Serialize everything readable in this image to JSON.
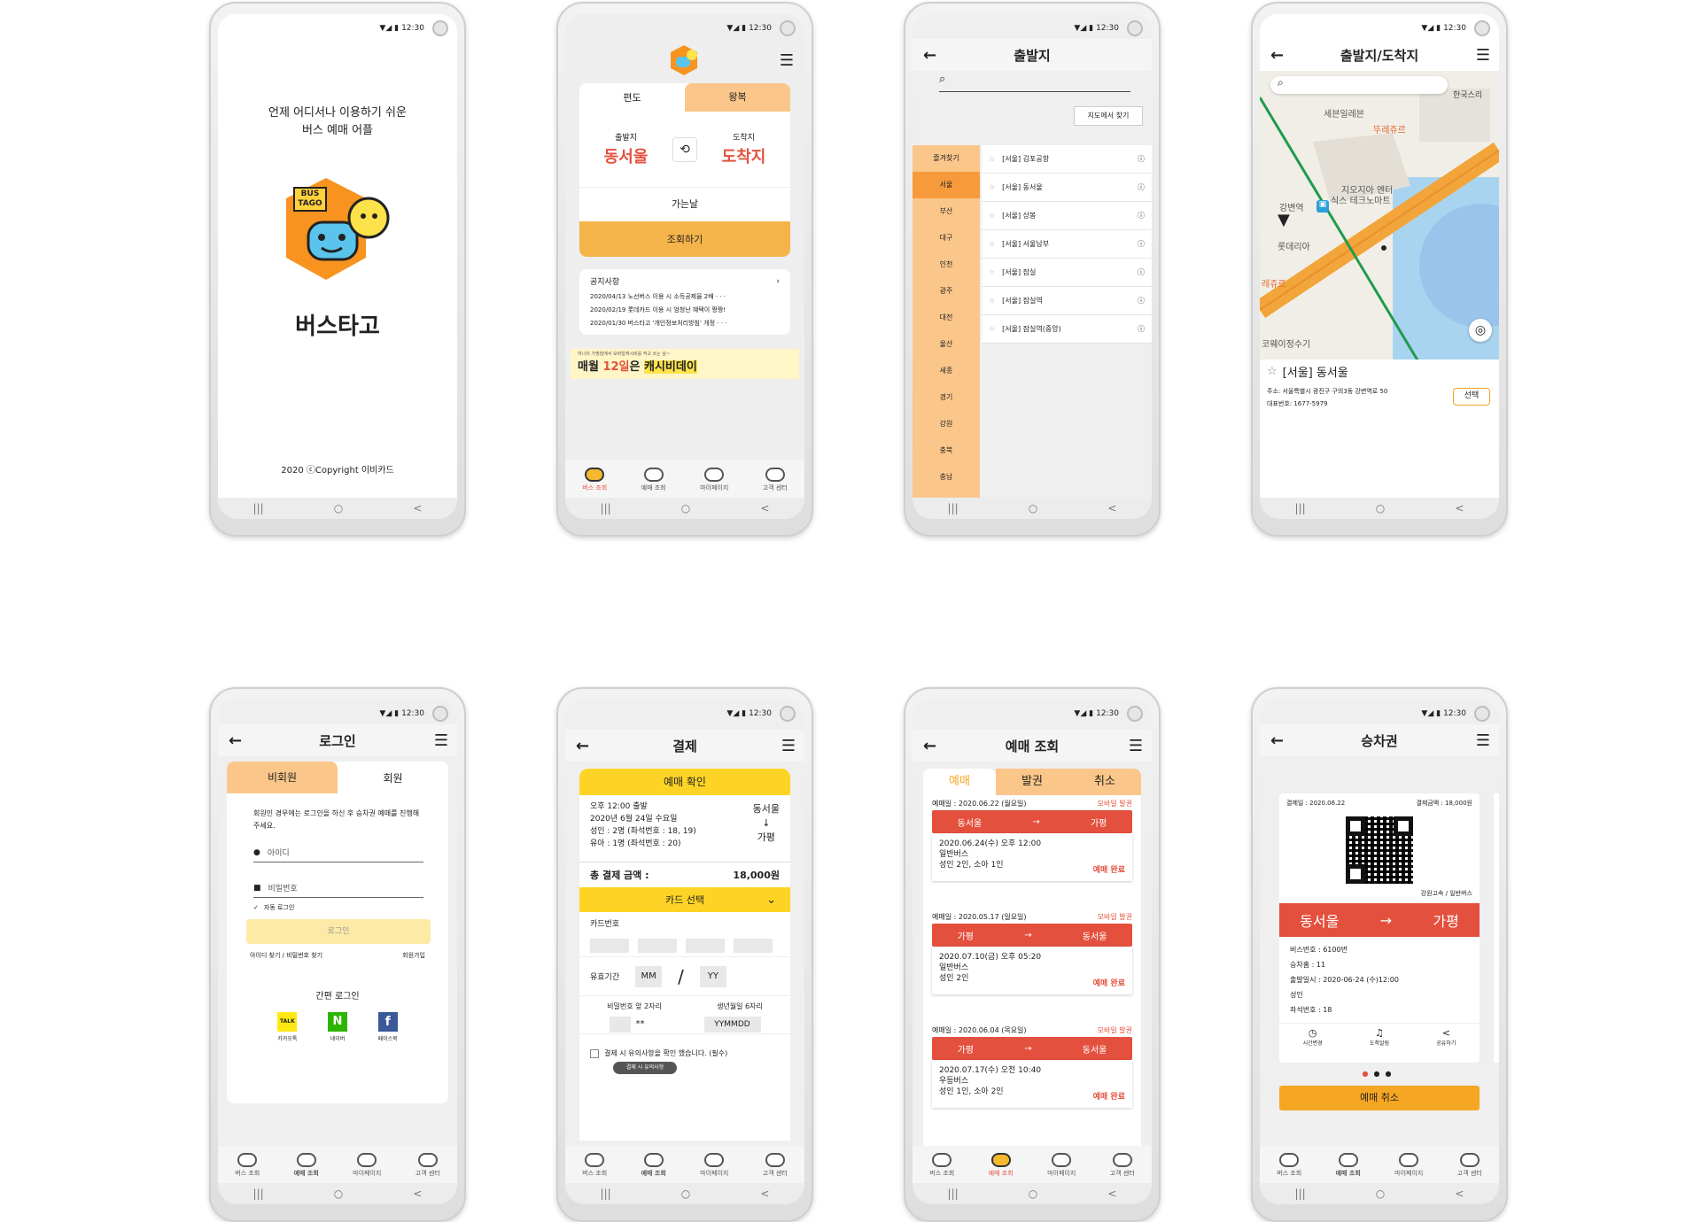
{
  "status_time": "12:30",
  "sys_nav": [
    "|||",
    "○",
    "<"
  ],
  "nav": {
    "search": "버스 조회",
    "booking": "예매 조회",
    "mypage": "마이페이지",
    "cs": "고객 센터"
  },
  "splash": {
    "tagline1": "언제 어디서나 이용하기 쉬운",
    "tagline2": "버스 예매 어플",
    "logo_text1": "BUS",
    "logo_text2": "TAGO",
    "app_name": "버스타고",
    "copyright": "2020 ⓒCopyright 이비카드"
  },
  "home": {
    "tab_oneway": "편도",
    "tab_round": "왕복",
    "depart_label": "출발지",
    "arrive_label": "도착지",
    "depart_value": "동서울",
    "arrive_value": "도착지",
    "date_label": "가는날",
    "search_btn": "조회하기",
    "notice_title": "공지사항",
    "notices": [
      "2020/04/13 노선버스 이용 시 소득공제율 2배 · · ·",
      "2020/02/19 롯데카드 이용 시 엄청난 혜택이 짱짱!",
      "2020/01/30 버스타고 '개인정보처리방침' 개정 · · ·"
    ],
    "banner_small": "하나의 가맹점에서 모바일캐시비를 적고 쓰는 날~",
    "banner_main1": "매월 ",
    "banner_main2": "12일",
    "banner_main3": "은 ",
    "banner_main4": "캐시비데이"
  },
  "departure": {
    "title": "출발지",
    "map_btn": "지도에서 찾기",
    "regions": [
      "즐겨찾기",
      "서울",
      "부산",
      "대구",
      "인천",
      "광주",
      "대전",
      "울산",
      "세종",
      "경기",
      "강원",
      "충북",
      "충남"
    ],
    "terminals": [
      "[서울] 김포공항",
      "[서울] 동서울",
      "[서울] 상봉",
      "[서울] 서울남부",
      "[서울] 잠실",
      "[서울] 잠실역",
      "[서울] 잠실역(중앙)"
    ]
  },
  "map": {
    "title": "출발지/도착지",
    "labels": [
      "세븐일레븐",
      "뚜레쥬르",
      "지오지아 엔터",
      "식스 테크노마트",
      "강변역",
      "롯데리아",
      "레쥬르",
      "코웨이정수기",
      "한국스리"
    ],
    "place_name": "[서울] 동서울",
    "address": "주소: 서울특별시 광진구 구의3동 강변역로 50",
    "phone": "대표번호: 1677-5979",
    "select_btn": "선택"
  },
  "login": {
    "title": "로그인",
    "tab_guest": "비회원",
    "tab_member": "회원",
    "info": "회원인 경우에는 로그인을 하신 후 승차권 예매를 진행해주세요.",
    "id_placeholder": "아이디",
    "pw_placeholder": "비밀번호",
    "auto_login": "자동 로그인",
    "login_btn": "로그인",
    "find": "아이디 찾기 / 비밀번호 찾기",
    "signup": "회원가입",
    "simple_login": "간편 로그인",
    "kakao": "카카오톡",
    "naver": "네이버",
    "facebook": "페이스북",
    "kakao_icon": "TALK",
    "naver_icon": "N",
    "facebook_icon": "f"
  },
  "payment": {
    "title": "결제",
    "confirm_title": "예매 확인",
    "line1": "오후 12:00 출발",
    "line2": "2020년 6월 24일 수요일",
    "line3": "성인 : 2명 (좌석번호 : 18, 19)",
    "line4": "유아 : 1명 (좌석번호 : 20)",
    "from": "동서울",
    "to": "가평",
    "arrow": "↓",
    "total_label": "총 결제 금액 :",
    "total_value": "18,000원",
    "card_select": "카드 선택",
    "card_no": "카드번호",
    "expiry": "유효기간",
    "mm": "MM",
    "yy": "YY",
    "pw2": "비밀번호 앞 2자리",
    "pw2_mask": "**",
    "birth": "생년월일 6자리",
    "birth_ph": "YYMMDD",
    "agree": "결제 시 유의사항을 확인 했습니다. (필수)",
    "notice_chip": "결제 시 유의사항"
  },
  "history": {
    "title": "예매 조회",
    "tabs": [
      "예매",
      "발권",
      "취소"
    ],
    "items": [
      {
        "date": "예매일 : 2020.06.22 (월요일)",
        "tag": "모바일 발권",
        "from": "동서울",
        "to": "가평",
        "when": "2020.06.24(수) 오후 12:00",
        "type": "일반버스",
        "pax": "성인 2인, 소아 1인",
        "status": "예매 완료"
      },
      {
        "date": "예매일 : 2020.05.17 (일요일)",
        "tag": "모바일 발권",
        "from": "가평",
        "to": "동서울",
        "when": "2020.07.10(금) 오후 05:20",
        "type": "일반버스",
        "pax": "성인 2인",
        "status": "예매 완료"
      },
      {
        "date": "예매일 : 2020.06.04 (목요일)",
        "tag": "모바일 발권",
        "from": "가평",
        "to": "동서울",
        "when": "2020.07.17(수) 오전 10:40",
        "type": "우등버스",
        "pax": "성인 1인, 소아 2인",
        "status": "예매 완료"
      }
    ],
    "arrow": "→"
  },
  "ticket": {
    "title": "승차권",
    "pay_date": "결제일 : 2020.06.22",
    "pay_amount": "결제금액 : 18,000원",
    "company": "강원고속 / 일반버스",
    "from": "동서울",
    "to": "가평",
    "arrow": "→",
    "bus_no": "버스번호 : 6100번",
    "platform": "승차홈 : 11",
    "depart": "출발일시 : 2020-06-24 (수)12:00",
    "grade": "성인",
    "seat": "좌석번호 : 18",
    "act_time": "시간변경",
    "act_alarm": "도착알림",
    "act_share": "공유하기",
    "cancel_btn": "예매 취소"
  }
}
